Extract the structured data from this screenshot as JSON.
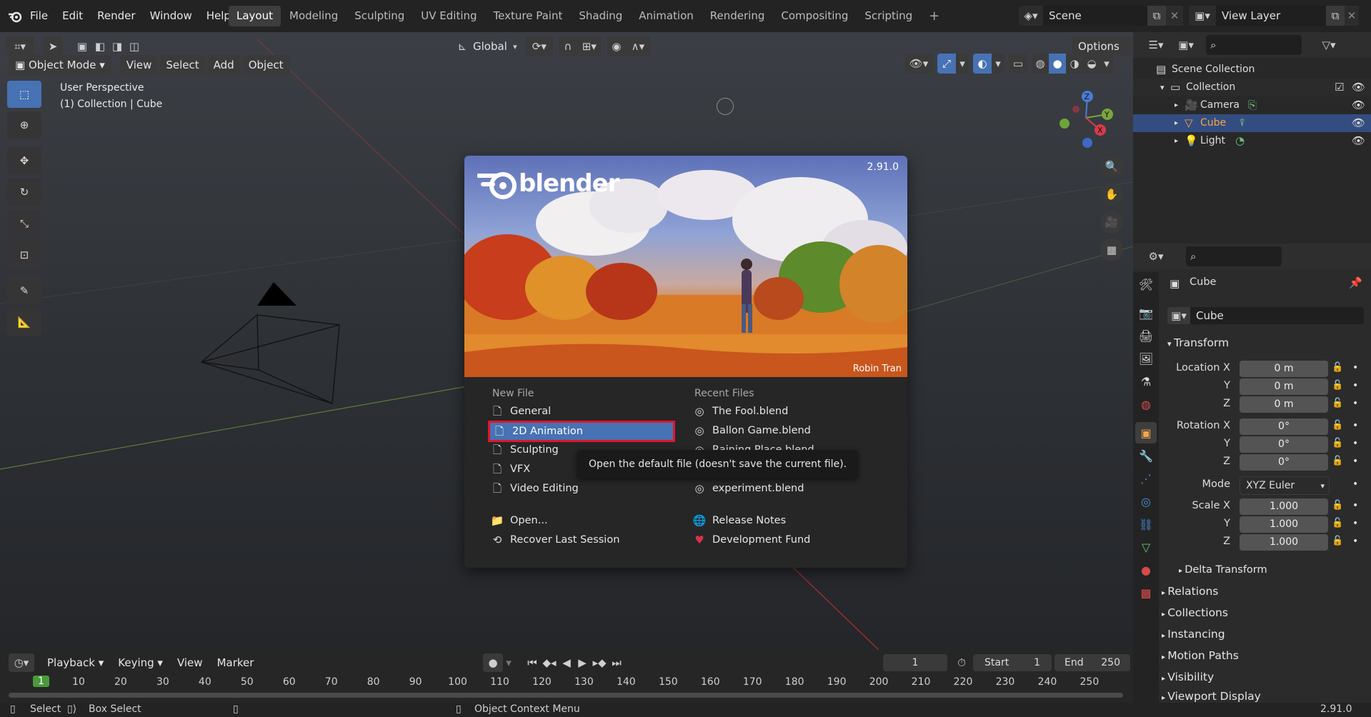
{
  "menu": {
    "items": [
      "File",
      "Edit",
      "Render",
      "Window",
      "Help"
    ],
    "workspaces": [
      "Layout",
      "Modeling",
      "Sculpting",
      "UV Editing",
      "Texture Paint",
      "Shading",
      "Animation",
      "Rendering",
      "Compositing",
      "Scripting"
    ],
    "active_workspace": "Layout",
    "add_tab": "+",
    "scene": "Scene",
    "view_layer": "View Layer"
  },
  "viewport_header": {
    "mode": "Object Mode",
    "menus": [
      "View",
      "Select",
      "Add",
      "Object"
    ],
    "orientation": "Global",
    "options": "Options"
  },
  "viewport": {
    "perspective": "User Perspective",
    "collection_info": "(1) Collection | Cube",
    "gizmo_axes": [
      "Z",
      "Y",
      "X"
    ]
  },
  "splash": {
    "version": "2.91.0",
    "logo_text": "blender",
    "artist_credit": "Robin Tran",
    "new_file_heading": "New File",
    "recent_heading": "Recent Files",
    "new_file_items": [
      {
        "label": "General",
        "icon": "file-new-icon"
      },
      {
        "label": "2D Animation",
        "icon": "file-new-icon"
      },
      {
        "label": "Sculpting",
        "icon": "file-new-icon"
      },
      {
        "label": "VFX",
        "icon": "file-new-icon"
      },
      {
        "label": "Video Editing",
        "icon": "file-new-icon"
      }
    ],
    "recent_items": [
      {
        "label": "The Fool.blend"
      },
      {
        "label": "Ballon Game.blend"
      },
      {
        "label": "Raining Place.blend"
      },
      {
        "label": "experiment.blend"
      }
    ],
    "open_label": "Open...",
    "recover_label": "Recover Last Session",
    "release_notes": "Release Notes",
    "dev_fund": "Development Fund",
    "tooltip": "Open the default file (doesn't save the current file)."
  },
  "outliner": {
    "scene_collection": "Scene Collection",
    "collection": "Collection",
    "objects": [
      "Camera",
      "Cube",
      "Light"
    ],
    "selected": "Cube"
  },
  "properties": {
    "object_name": "Cube",
    "object_field": "Cube",
    "transform_title": "Transform",
    "location_label": "Location X",
    "rotation_label": "Rotation X",
    "scale_label": "Scale X",
    "axis_y": "Y",
    "axis_z": "Z",
    "location": [
      "0 m",
      "0 m",
      "0 m"
    ],
    "rotation": [
      "0°",
      "0°",
      "0°"
    ],
    "mode_label": "Mode",
    "mode_value": "XYZ Euler",
    "scale": [
      "1.000",
      "1.000",
      "1.000"
    ],
    "delta_transform": "Delta Transform",
    "sections": [
      "Relations",
      "Collections",
      "Instancing",
      "Motion Paths",
      "Visibility",
      "Viewport Display"
    ]
  },
  "timeline": {
    "menus": [
      "Playback",
      "Keying",
      "View",
      "Marker"
    ],
    "current_frame": "1",
    "start_label": "Start",
    "start_value": "1",
    "end_label": "End",
    "end_value": "250",
    "ticks": [
      "1",
      "10",
      "20",
      "30",
      "40",
      "50",
      "60",
      "70",
      "80",
      "90",
      "100",
      "110",
      "120",
      "130",
      "140",
      "150",
      "160",
      "170",
      "180",
      "190",
      "200",
      "210",
      "220",
      "230",
      "240",
      "250"
    ]
  },
  "status": {
    "select": "Select",
    "box_select": "Box Select",
    "context_menu": "Object Context Menu",
    "version": "2.91.0"
  },
  "colors": {
    "accent_blue": "#4772b3",
    "highlight_red": "#e0162b",
    "selected_row": "#334d80",
    "object_orange": "#f5a44a"
  }
}
